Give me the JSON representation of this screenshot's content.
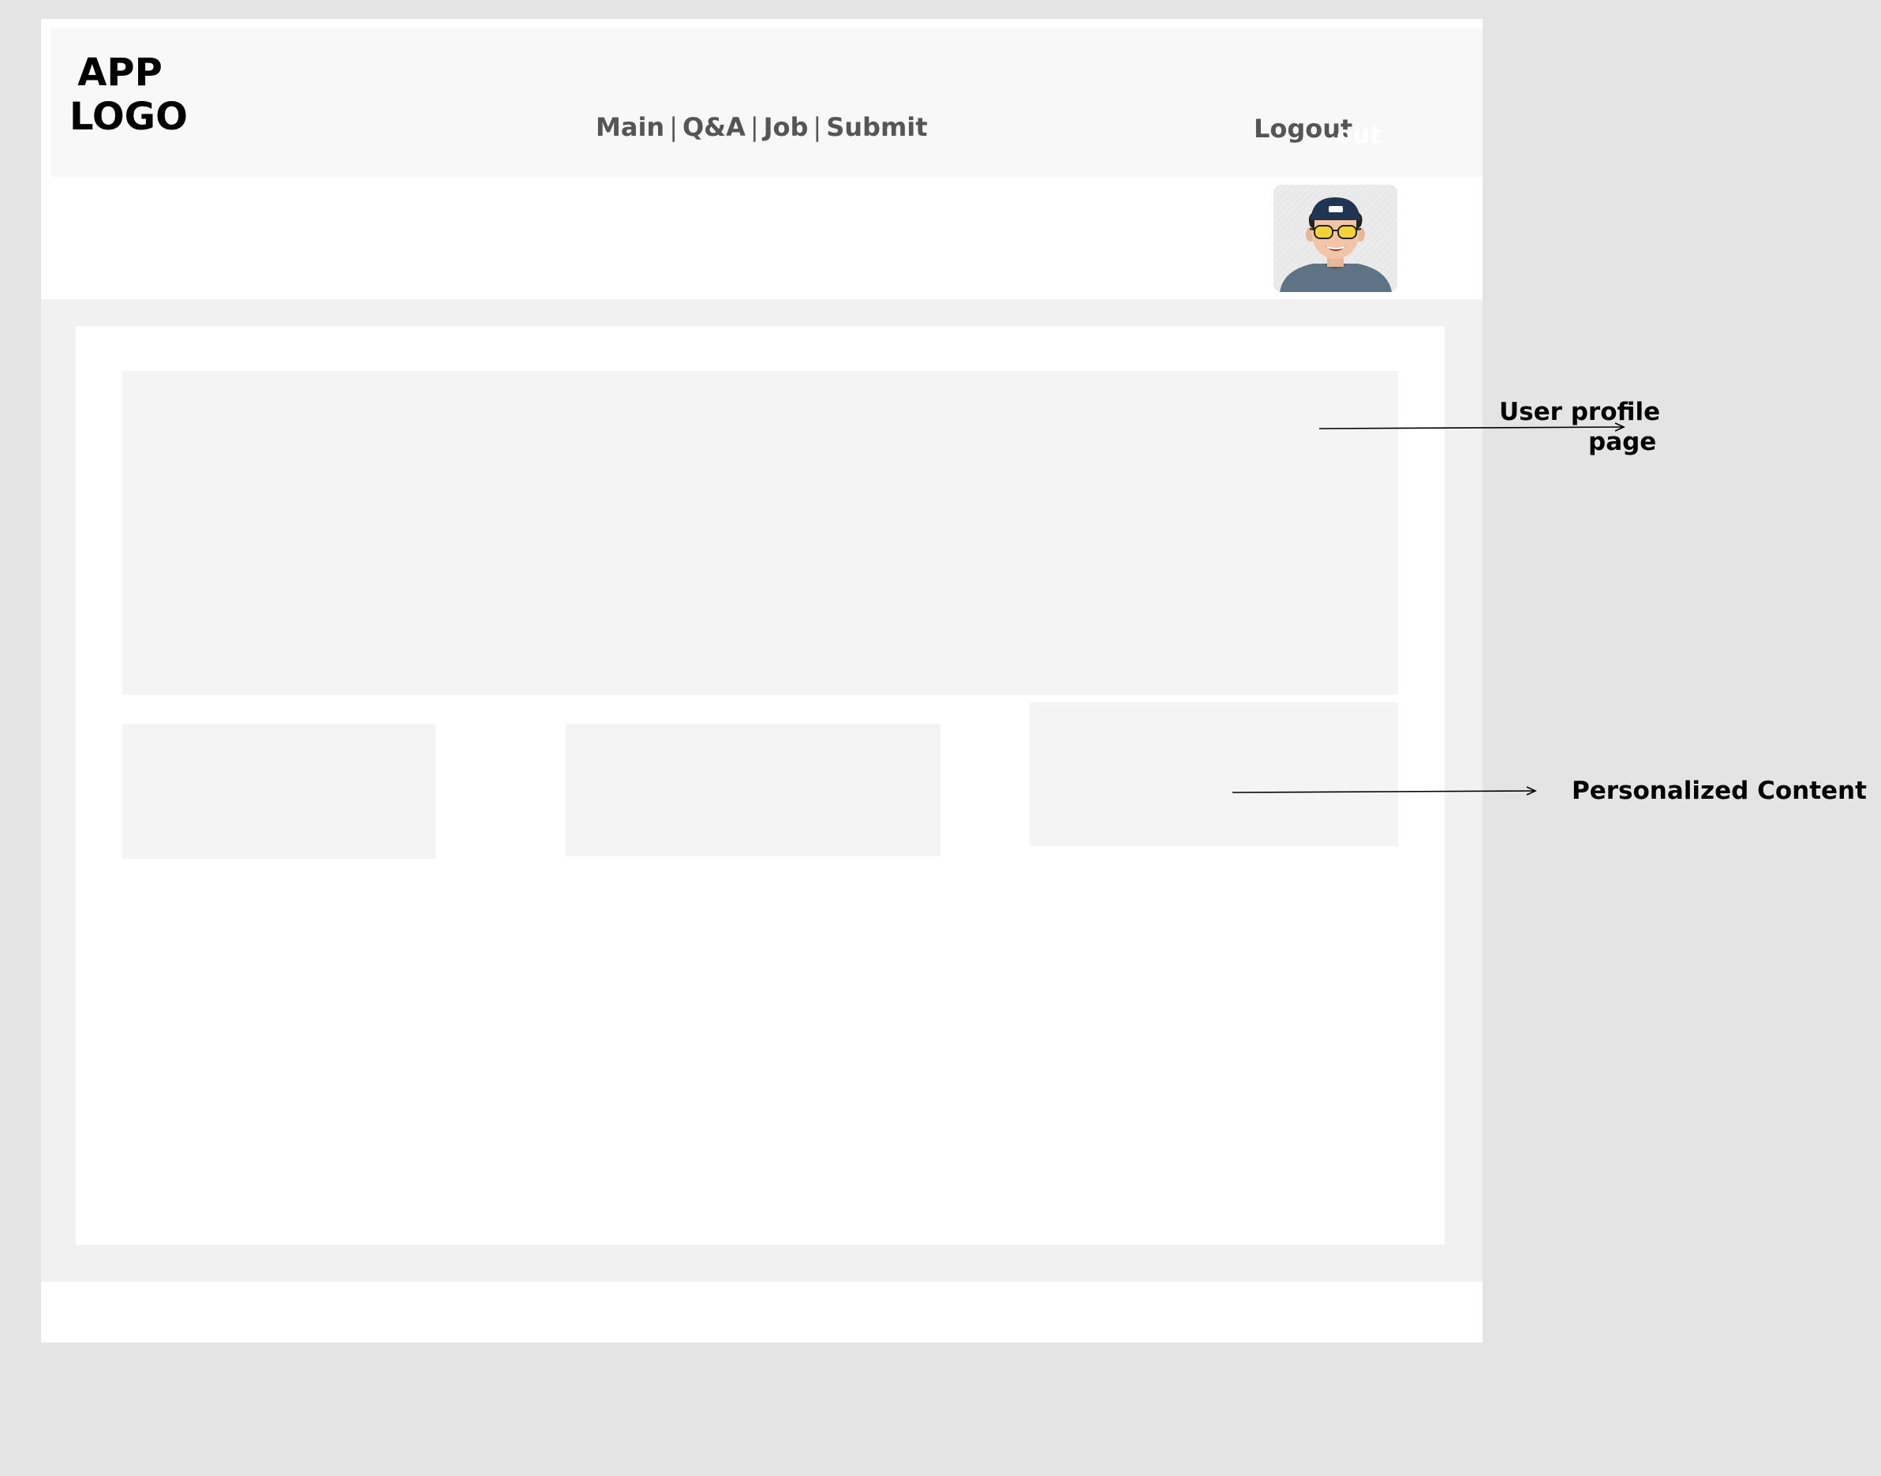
{
  "app": {
    "logo": "APP\nLOGO"
  },
  "nav": {
    "items": [
      "Main",
      "Q&A",
      "Job",
      "Submit"
    ],
    "separator": "|"
  },
  "header": {
    "logout_label": "Logout",
    "ghost_text": "out"
  },
  "annotations": {
    "profile_line1": "User  profile",
    "profile_line2": "page",
    "personalized": "Personalized Content"
  },
  "icons": {
    "avatar": "user-avatar-cartoon",
    "arrow": "arrow-right-icon"
  },
  "colors": {
    "background": "#e4e4e4",
    "header": "#f8f8f8",
    "placeholder": "#f4f4f4",
    "nav_text": "#555555"
  }
}
